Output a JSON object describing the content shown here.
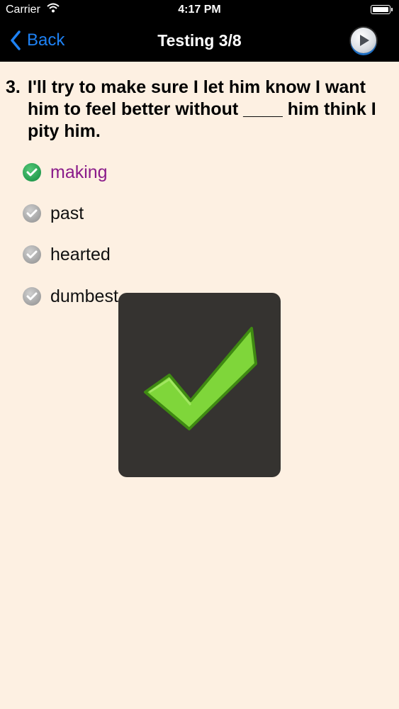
{
  "status_bar": {
    "carrier": "Carrier",
    "time": "4:17 PM"
  },
  "nav": {
    "back_label": "Back",
    "title": "Testing 3/8",
    "play_icon": "play-icon"
  },
  "question": {
    "number": "3.",
    "text": "I'll try to make sure I let him know I want him to feel better without ____ him think I pity him."
  },
  "options": [
    {
      "label": "making",
      "state": "correct"
    },
    {
      "label": "past",
      "state": "neutral"
    },
    {
      "label": "hearted",
      "state": "neutral"
    },
    {
      "label": "dumbest",
      "state": "neutral"
    }
  ],
  "feedback": {
    "icon": "checkmark-icon",
    "result": "correct"
  },
  "colors": {
    "background": "#fdf0e2",
    "nav_background": "#000000",
    "back_accent": "#1e82f5",
    "selected_option": "#8a1b8a",
    "check_green": "#7fd63a",
    "overlay": "#353330"
  }
}
